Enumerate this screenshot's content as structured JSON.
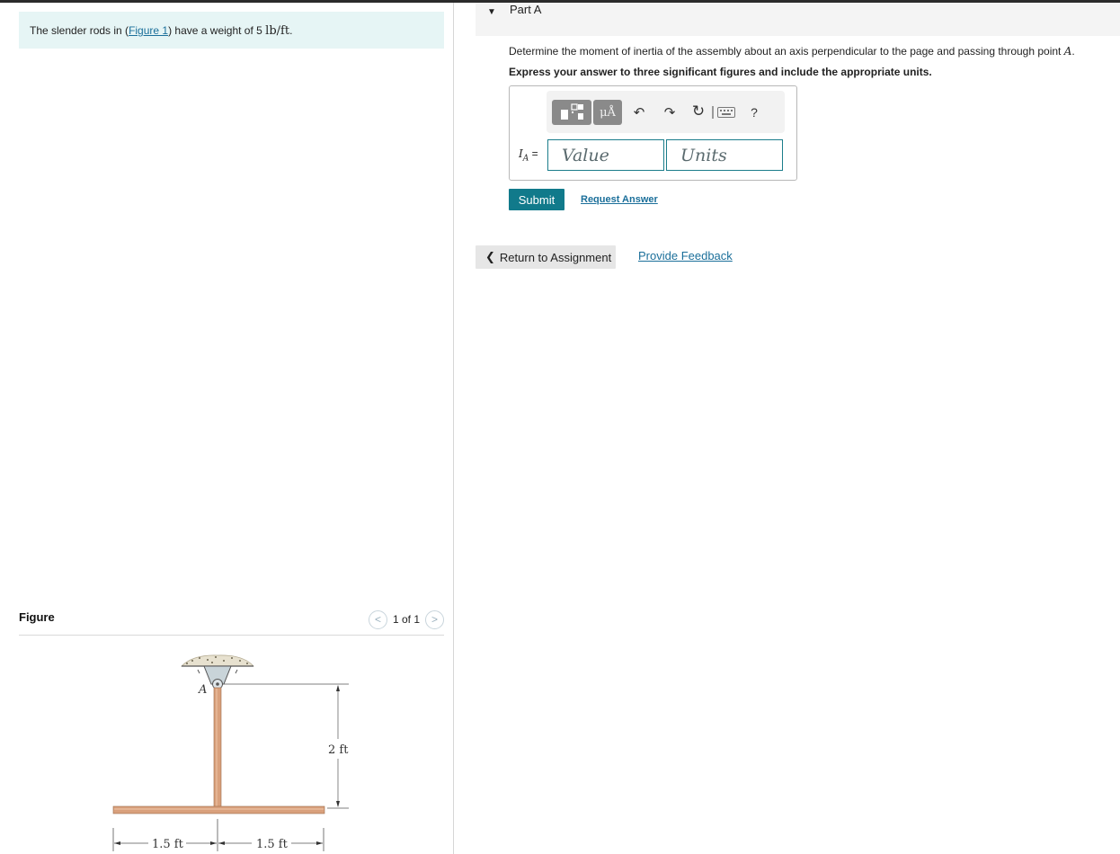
{
  "problem": {
    "text_prefix": "The slender rods in (",
    "figure_link": "Figure 1",
    "text_middle": ") have a weight of 5 ",
    "unit": "lb/ft",
    "text_suffix": "."
  },
  "figure_panel": {
    "title": "Figure",
    "pager_prev": "<",
    "pager_text": "1 of 1",
    "pager_next": ">",
    "figure": {
      "point_label": "A",
      "height_label": "2 ft",
      "left_label": "1.5 ft",
      "right_label": "1.5 ft"
    }
  },
  "part": {
    "caret": "▼",
    "title": "Part A",
    "question_prefix": "Determine the moment of inertia of the assembly about an axis perpendicular to the page and passing through point ",
    "question_point": "A",
    "question_suffix": ".",
    "instruction": "Express your answer to three significant figures and include the appropriate units.",
    "toolbar": {
      "mu_label": "μÅ",
      "undo": "↶",
      "redo": "↷",
      "reset": "↻",
      "help": "?"
    },
    "variable": "I",
    "variable_sub": "A",
    "equals": " =",
    "value_placeholder": "Value",
    "units_placeholder": "Units",
    "submit_label": "Submit",
    "request_answer": "Request Answer"
  },
  "footer": {
    "return_label": "Return to Assignment",
    "feedback_label": "Provide Feedback"
  },
  "colors": {
    "accent": "#117a8b",
    "link": "#1b6f9a",
    "problem_bg": "#e6f5f5",
    "rod": "#d9a07c"
  }
}
